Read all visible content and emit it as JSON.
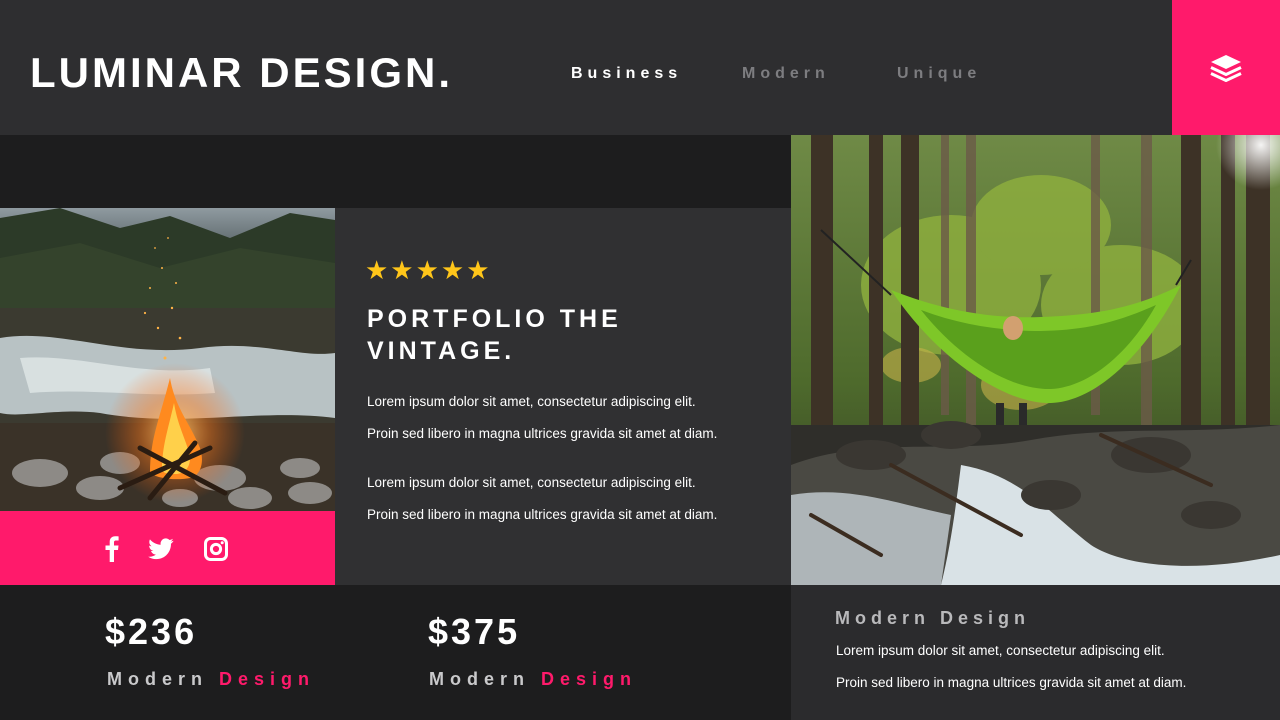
{
  "header": {
    "brand": "LUMINAR DESIGN.",
    "nav": [
      "Business",
      "Modern",
      "Unique"
    ],
    "menu_icon": "layers-icon"
  },
  "social": {
    "icons": [
      "facebook-icon",
      "twitter-icon",
      "instagram-icon"
    ]
  },
  "card": {
    "stars": "★★★★★",
    "rating": 5,
    "title": "PORTFOLIO THE VINTAGE.",
    "paragraphs": [
      "Lorem ipsum dolor sit amet, consectetur adipiscing elit.",
      "Proin sed libero in magna ultrices gravida sit amet at diam.",
      "Lorem ipsum dolor sit amet, consectetur adipiscing elit.",
      "Proin sed libero in magna ultrices gravida sit amet at diam."
    ]
  },
  "prices": [
    {
      "value": "$236",
      "label_a": "Modern",
      "label_b": "Design"
    },
    {
      "value": "$375",
      "label_a": "Modern",
      "label_b": "Design"
    }
  ],
  "feature": {
    "title": "Modern Design",
    "lines": [
      "Lorem ipsum dolor sit amet, consectetur adipiscing elit.",
      "Proin sed libero in magna ultrices gravida sit amet at diam."
    ]
  },
  "colors": {
    "accent": "#ff1a6b",
    "star": "#ffc61a",
    "header_bg": "#2e2e30",
    "page_bg": "#1f1f20"
  }
}
